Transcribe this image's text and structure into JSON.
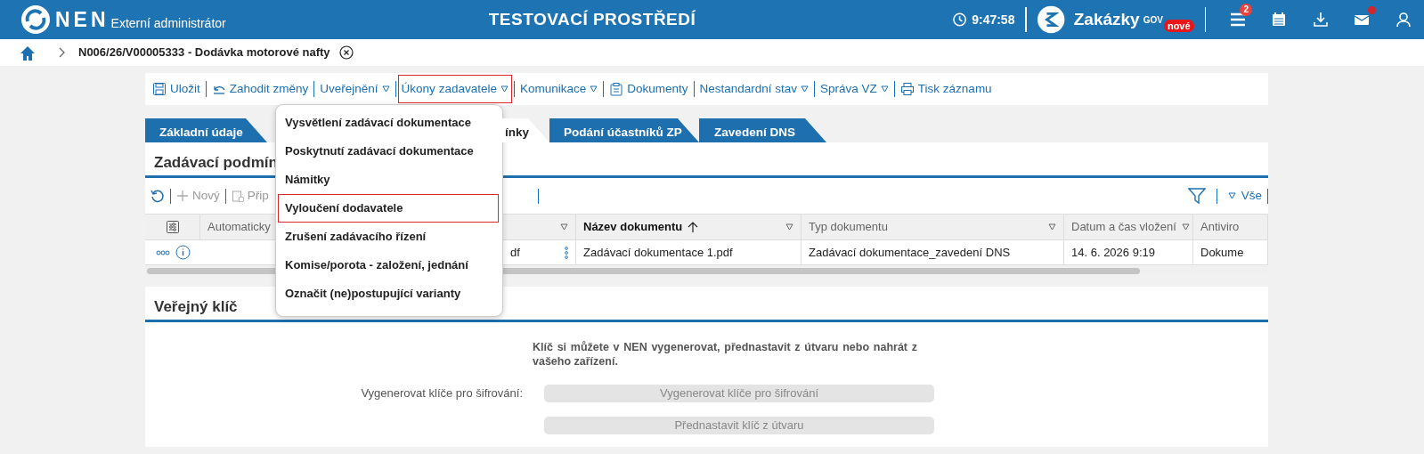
{
  "header": {
    "product": "NEN",
    "subtitle": "Externí administrátor",
    "environment": "TESTOVACÍ PROSTŘEDÍ",
    "time": "9:47:58",
    "brand": {
      "name": "Zakázky",
      "sup": "GOV",
      "badge": "nové"
    },
    "icons": [
      {
        "kind": "menu",
        "badge": "2"
      },
      {
        "kind": "calendar"
      },
      {
        "kind": "download"
      },
      {
        "kind": "mail",
        "dot": true
      },
      {
        "kind": "user"
      }
    ]
  },
  "breadcrumb": {
    "title": "N006/26/V00005333 - Dodávka motorové nafty"
  },
  "toolbar": [
    {
      "label": "Uložit",
      "kind": "save",
      "dropdown": false,
      "open": false
    },
    {
      "label": "Zahodit změny",
      "kind": "undo",
      "dropdown": false,
      "open": false
    },
    {
      "label": "Uveřejnění",
      "dropdown": true,
      "open": false
    },
    {
      "label": "Úkony zadavatele",
      "dropdown": true,
      "open": true
    },
    {
      "label": "Komunikace",
      "dropdown": true,
      "open": false
    },
    {
      "label": "Dokumenty",
      "kind": "clipboard",
      "dropdown": false,
      "open": false
    },
    {
      "label": "Nestandardní stav",
      "dropdown": true,
      "open": false
    },
    {
      "label": "Správa VZ",
      "dropdown": true,
      "open": false
    },
    {
      "label": "Tisk záznamu",
      "kind": "print",
      "dropdown": false,
      "open": false
    }
  ],
  "tabs": [
    {
      "label": "Základní údaje",
      "selected": false
    },
    {
      "label": "ínky",
      "selected": true
    },
    {
      "label": "Podání účastníků ZP",
      "selected": false
    },
    {
      "label": "Zavedení DNS",
      "selected": false
    }
  ],
  "dropdown_menu": [
    {
      "label": "Vysvětlení zadávací dokumentace",
      "focused": false
    },
    {
      "label": "Poskytnutí zadávací dokumentace",
      "focused": false
    },
    {
      "label": "Námitky",
      "focused": false
    },
    {
      "label": "Vyloučení dodavatele",
      "focused": true
    },
    {
      "label": "Zrušení zadávacího řízení",
      "focused": false
    },
    {
      "label": "Komise/porota - založení, jednání",
      "focused": false
    },
    {
      "label": "Označit (ne)postupující varianty",
      "focused": false
    }
  ],
  "documents_panel": {
    "title": "Zadávací podmín",
    "actions": [
      {
        "kind": "plus",
        "label": "Nový"
      },
      {
        "kind": "attach",
        "label": "Přip"
      }
    ],
    "filter_label": "Vše",
    "columns": [
      {
        "label": "Automaticky",
        "sorted": false
      },
      {
        "filter": true,
        "sorted": false
      },
      {
        "label": "Název dokumentu",
        "filter": true,
        "sorted": true
      },
      {
        "label": "Typ dokumentu",
        "filter": true,
        "sorted": false
      },
      {
        "label": "Datum a čas vložení",
        "filter": true,
        "sorted": false
      },
      {
        "label": "Antiviro",
        "filter": false,
        "sorted": false
      }
    ],
    "rows": [
      {
        "cells": [
          null,
          "df",
          "Zadávací dokumentace 1.pdf",
          "Zadávací dokumentace_zavedení DNS",
          "14. 6. 2026 9:19",
          "Dokume"
        ]
      }
    ]
  },
  "public_key_panel": {
    "title": "Veřejný klíč",
    "note": "Klíč si můžete v NEN vygenerovat, přednastavit z útvaru nebo nahrát z vašeho zařízení.",
    "generate_label": "Vygenerovat klíče pro šifrování:",
    "buttons": [
      {
        "label": "Vygenerovat klíče pro šifrování",
        "disabled": true
      },
      {
        "label": "Přednastavit klíč z útvaru",
        "disabled": true
      }
    ]
  }
}
